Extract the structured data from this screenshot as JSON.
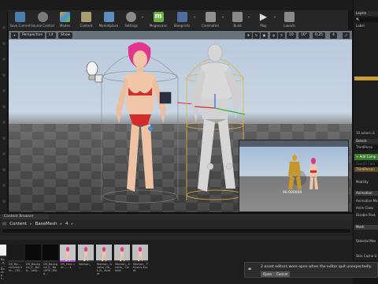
{
  "toolbar": {
    "items": [
      {
        "label": "Save Current",
        "icon": "save-icon",
        "color": "#4a7fb0"
      },
      {
        "label": "Source Control",
        "icon": "source-control-icon",
        "color": "#7a7a7a"
      },
      {
        "label": "Modes",
        "icon": "modes-icon",
        "color": "#9a6a3a"
      },
      {
        "label": "Content",
        "icon": "content-icon",
        "color": "#a8a070"
      },
      {
        "label": "Marketplace",
        "icon": "marketplace-icon",
        "color": "#5a8fc0"
      },
      {
        "label": "Settings",
        "icon": "settings-icon",
        "color": "#8a8a8a"
      },
      {
        "label": "Megascans",
        "icon": "megascans-icon",
        "color": "#6ab344"
      },
      {
        "label": "Blueprints",
        "icon": "blueprints-icon",
        "color": "#4d6fa0"
      },
      {
        "label": "Cinematics",
        "icon": "cinematics-icon",
        "color": "#909090"
      },
      {
        "label": "Build",
        "icon": "build-icon",
        "color": "#8a8a8a"
      },
      {
        "label": "Play",
        "icon": "play-icon",
        "color": "#d8d8d8"
      },
      {
        "label": "Launch",
        "icon": "launch-icon",
        "color": "#8a8a8a"
      }
    ]
  },
  "viewport": {
    "view_mode": "Perspective",
    "lit": "Lit",
    "show": "Show",
    "snap_grid": "10",
    "snap_rot": "10°",
    "snap_scale": "0,25",
    "cam_speed": "4",
    "preview_label": "90.000000"
  },
  "right_panel": {
    "header": "Layers",
    "label": "Label",
    "outliner_rows": [
      "",
      "",
      "",
      "",
      "",
      "",
      "",
      "",
      "",
      "",
      "",
      "",
      "",
      "",
      ""
    ],
    "actor_count": "10 actors (1",
    "details": "Details",
    "actor_name": "ThirdPerso",
    "add_component": "+ Add Comp",
    "search_placeholder": "Search Com",
    "selected_component": "ThirdPerson",
    "mobility": "Mobility",
    "animation_section": "Animation",
    "animation_mode": "Animation Mo",
    "anim_class": "Anim Class",
    "disable_post": "Disable Post",
    "mesh_section": "Mesh",
    "skeletal_mesh": "Skeletal Mes",
    "skin_cache": "Skin Cache U"
  },
  "content_browser": {
    "tab": "Content Browser",
    "path": [
      "Content",
      "BaseMesh",
      "4"
    ],
    "assets": [
      {
        "label": "Ba_d_ _... Backgr..."
      },
      {
        "label": "DS_Ba... ckGradi ent... (50..."
      },
      {
        "label": "DS_Backg nd_E_ Bulb... (alt)..."
      },
      {
        "label": "DS_Backg nd_E_ BackFill _Map..."
      },
      {
        "label": "DS_Hair. cut... ...1"
      },
      {
        "label": "Woman_ ..."
      },
      {
        "label": "Woman_ Avatar_Ha_ t_Ik_ Avatar"
      },
      {
        "label": "Woman_ Avatar_ Collada"
      },
      {
        "label": "Woman_ Physics Asset"
      }
    ],
    "status": "",
    "view_options": ""
  },
  "notification": {
    "text": "2 asset editors were open when the editor quit unexpectedly.",
    "open": "Open",
    "cancel": "Cancel"
  }
}
